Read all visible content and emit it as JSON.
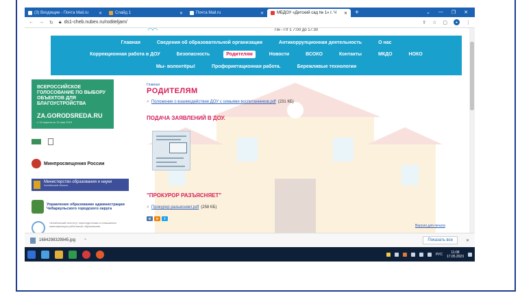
{
  "browser": {
    "tabs": [
      {
        "label": "(3) Входящие - Почта Mail.ru",
        "active": false
      },
      {
        "label": "Слайд 1",
        "active": false
      },
      {
        "label": "Почта Mail.ru",
        "active": false
      },
      {
        "label": "МБДОУ «Детский сад № 1» г. Ч",
        "active": true
      }
    ],
    "new_tab": "+",
    "url": "ds1-cheb.nubex.ru/roditeljam/"
  },
  "site": {
    "hours": "Пн - Пт с 7:00 до 17:30",
    "nav_row1": [
      "Главная",
      "Сведения об образовательной организации",
      "Антикоррупционная деятельность",
      "О нас"
    ],
    "nav_row2": [
      "Коррекционная работа в ДОУ",
      "Безопасность",
      "Родителям",
      "Новости",
      "ВСОКО",
      "Контакты",
      "МКДО",
      "НОКО"
    ],
    "nav_row3": [
      "Мы- волонтёры!",
      "Профориетационная работа.",
      "Бережливые технологии"
    ],
    "active_nav": "Родителям"
  },
  "sidebar": {
    "green_title": "ВСЕРОССИЙСКОЕ ГОЛОСОВАНИЕ ПО ВЫБОРУ ОБЪЕКТОВ ДЛЯ БЛАГОУСТРОЙСТВА",
    "green_domain": "ZA.GORODSREDA.RU",
    "green_dates": "с 15 апреля по 31 мая 2023",
    "minpros": "Минпросвещения России",
    "minobr": "Министерство образования и науки",
    "minobr_sub": "Челябинской области",
    "upr": "Управление образование администрации Чебаркульского городского округа",
    "chel": "Челябинский институт переподготовки и повышения квалификации работников образования"
  },
  "content": {
    "breadcrumb": "Главная",
    "title": "РОДИТЕЛЯМ",
    "doc1_link": "Положение о взаимодействии ДОУ с семьями воспитанников.pdf",
    "doc1_size": "(231 КБ)",
    "apply_heading": "ПОДАЧА ЗАЯВЛЕНИЙ В ДОУ.",
    "prok_heading": "\"ПРОКУРОР РАЗЪЯСНЯЕТ\"",
    "doc2_link": "Прокурор разъясняет.pdf",
    "doc2_size": "(258 КБ)",
    "version_link": "Версия для печати",
    "social": [
      "vk",
      "ok",
      "tw"
    ]
  },
  "downloads": {
    "filename": "1684298329845.jpg",
    "show_all": "Показать все"
  },
  "taskbar": {
    "lang": "РУС",
    "time": "11:08",
    "date": "17.05.2023"
  }
}
